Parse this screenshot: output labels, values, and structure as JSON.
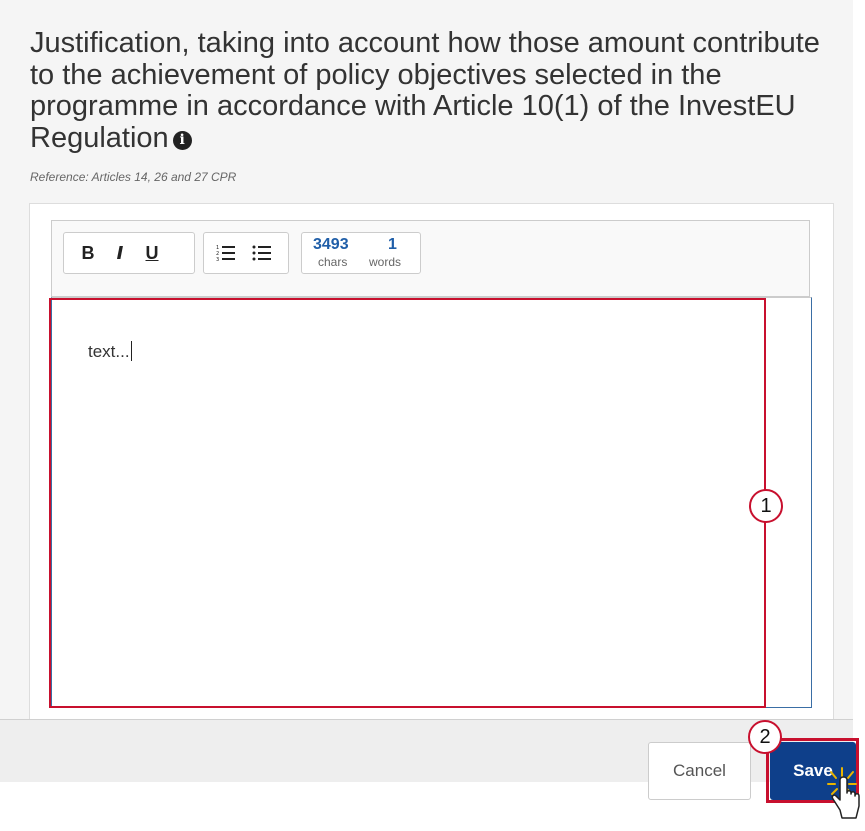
{
  "section": {
    "heading": "Justification, taking into account how those amount contribute to the achievement of policy objectives selected in the programme in accordance with Article 10(1) of the InvestEU Regulation",
    "info_icon": "i",
    "reference": "Reference: Articles 14, 26 and 27 CPR"
  },
  "toolbar": {
    "bold_label": "B",
    "italic_label": "I",
    "underline_label": "U",
    "ordered_list_icon": "ordered-list",
    "bullet_list_icon": "bullet-list",
    "chars_count": "3493",
    "chars_label": "chars",
    "words_count": "1",
    "words_label": "words"
  },
  "editor": {
    "content": "text..."
  },
  "callouts": {
    "editor_step": "1",
    "save_step": "2"
  },
  "footer": {
    "cancel_label": "Cancel",
    "save_label": "Save"
  },
  "colors": {
    "primary": "#0e3f8a",
    "counter": "#1f5ea8",
    "highlight": "#c8102e"
  }
}
